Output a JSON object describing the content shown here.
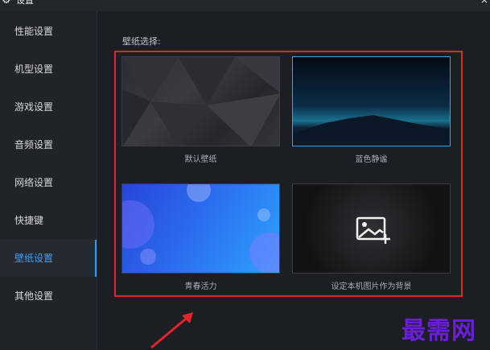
{
  "window": {
    "title": "设置"
  },
  "sidebar": {
    "items": [
      {
        "label": "性能设置",
        "active": false
      },
      {
        "label": "机型设置",
        "active": false
      },
      {
        "label": "游戏设置",
        "active": false
      },
      {
        "label": "音频设置",
        "active": false
      },
      {
        "label": "网络设置",
        "active": false
      },
      {
        "label": "快捷键",
        "active": false
      },
      {
        "label": "壁纸设置",
        "active": true
      },
      {
        "label": "其他设置",
        "active": false
      }
    ]
  },
  "main": {
    "section_title": "壁纸选择:",
    "wallpapers": [
      {
        "label": "默认壁纸"
      },
      {
        "label": "蓝色静谧"
      },
      {
        "label": "青春活力"
      },
      {
        "label": "设定本机图片作为背景"
      }
    ]
  },
  "watermark": {
    "text": "最需网"
  },
  "colors": {
    "accent": "#2f9bff",
    "highlight": "#e2242c",
    "watermark": "#6a1fd6"
  }
}
